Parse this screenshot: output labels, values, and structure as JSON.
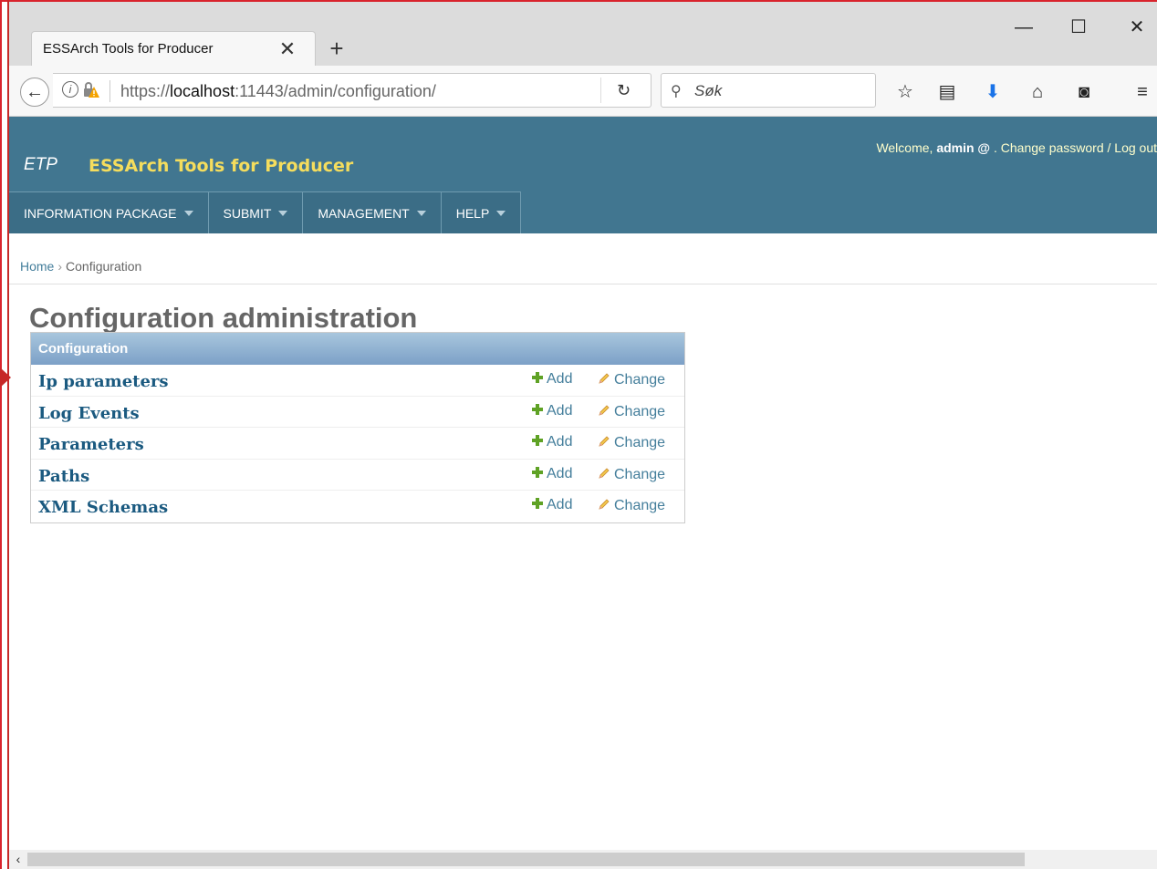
{
  "browser": {
    "tab_title": "ESSArch Tools for Producer",
    "tab_close_glyph": "✕",
    "new_tab_glyph": "+",
    "window_controls": {
      "minimize": "—",
      "maximize": "☐",
      "close": "✕"
    },
    "url_prefix": "https://",
    "url_host": "localhost",
    "url_rest": ":11443/admin/configuration/",
    "search_placeholder": "Søk",
    "toolbar_icons": [
      "star-icon",
      "reading-list-icon",
      "download-icon",
      "home-icon",
      "pocket-icon",
      "menu-icon"
    ]
  },
  "header": {
    "logo_abbr": "ETP",
    "site_name": "ESSArch Tools for Producer",
    "welcome_text": "Welcome, ",
    "username": "admin @",
    "user_links_text": " . Change password / Log out"
  },
  "menu": [
    {
      "label": "INFORMATION PACKAGE"
    },
    {
      "label": "SUBMIT"
    },
    {
      "label": "MANAGEMENT"
    },
    {
      "label": "HELP"
    }
  ],
  "breadcrumbs": {
    "home": "Home",
    "separator": "›",
    "current": "Configuration"
  },
  "page_title": "Configuration administration",
  "module": {
    "caption": "Configuration",
    "add_label": "Add",
    "change_label": "Change",
    "models": [
      {
        "name": "Ip parameters"
      },
      {
        "name": "Log Events"
      },
      {
        "name": "Parameters"
      },
      {
        "name": "Paths"
      },
      {
        "name": "XML Schemas"
      }
    ]
  },
  "colors": {
    "header_bg": "#417690",
    "site_name": "#f5dd5d",
    "link": "#447e9b",
    "model_link": "#1b5a80",
    "add_icon": "#5fa225"
  }
}
